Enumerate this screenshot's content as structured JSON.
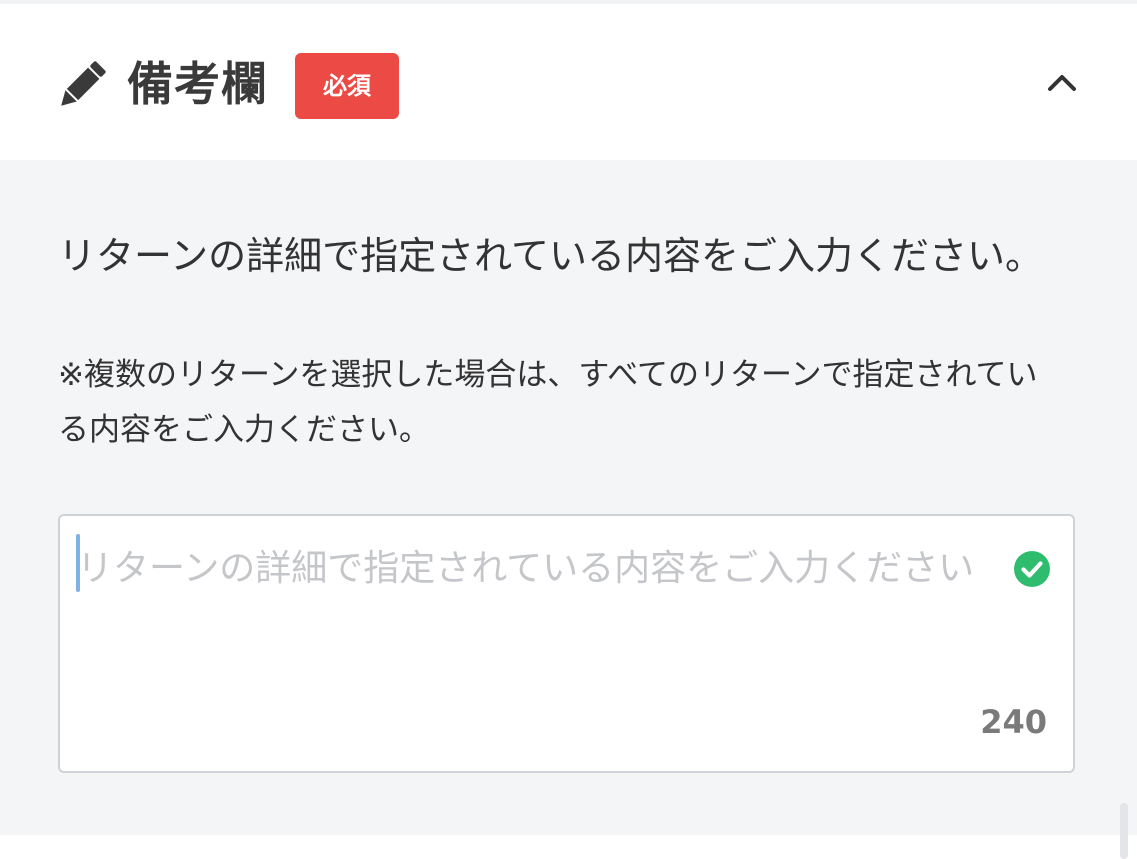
{
  "section": {
    "title": "備考欄",
    "required_badge": "必須",
    "icon": "pencil-icon",
    "toggle_icon": "chevron-up-icon"
  },
  "instruction": "リターンの詳細で指定されている内容をご入力ください。",
  "note": "※複数のリターンを選択した場合は、すべてのリターンで指定されている内容をご入力ください。",
  "textarea": {
    "placeholder": "リターンの詳細で指定されている内容をご入力ください",
    "value": "",
    "char_count": "240",
    "status_icon": "check-circle-icon"
  },
  "colors": {
    "badge": "#ec4a45",
    "check": "#2ebd6e",
    "panel_bg": "#f4f5f7",
    "cursor": "#7fb2e5"
  }
}
